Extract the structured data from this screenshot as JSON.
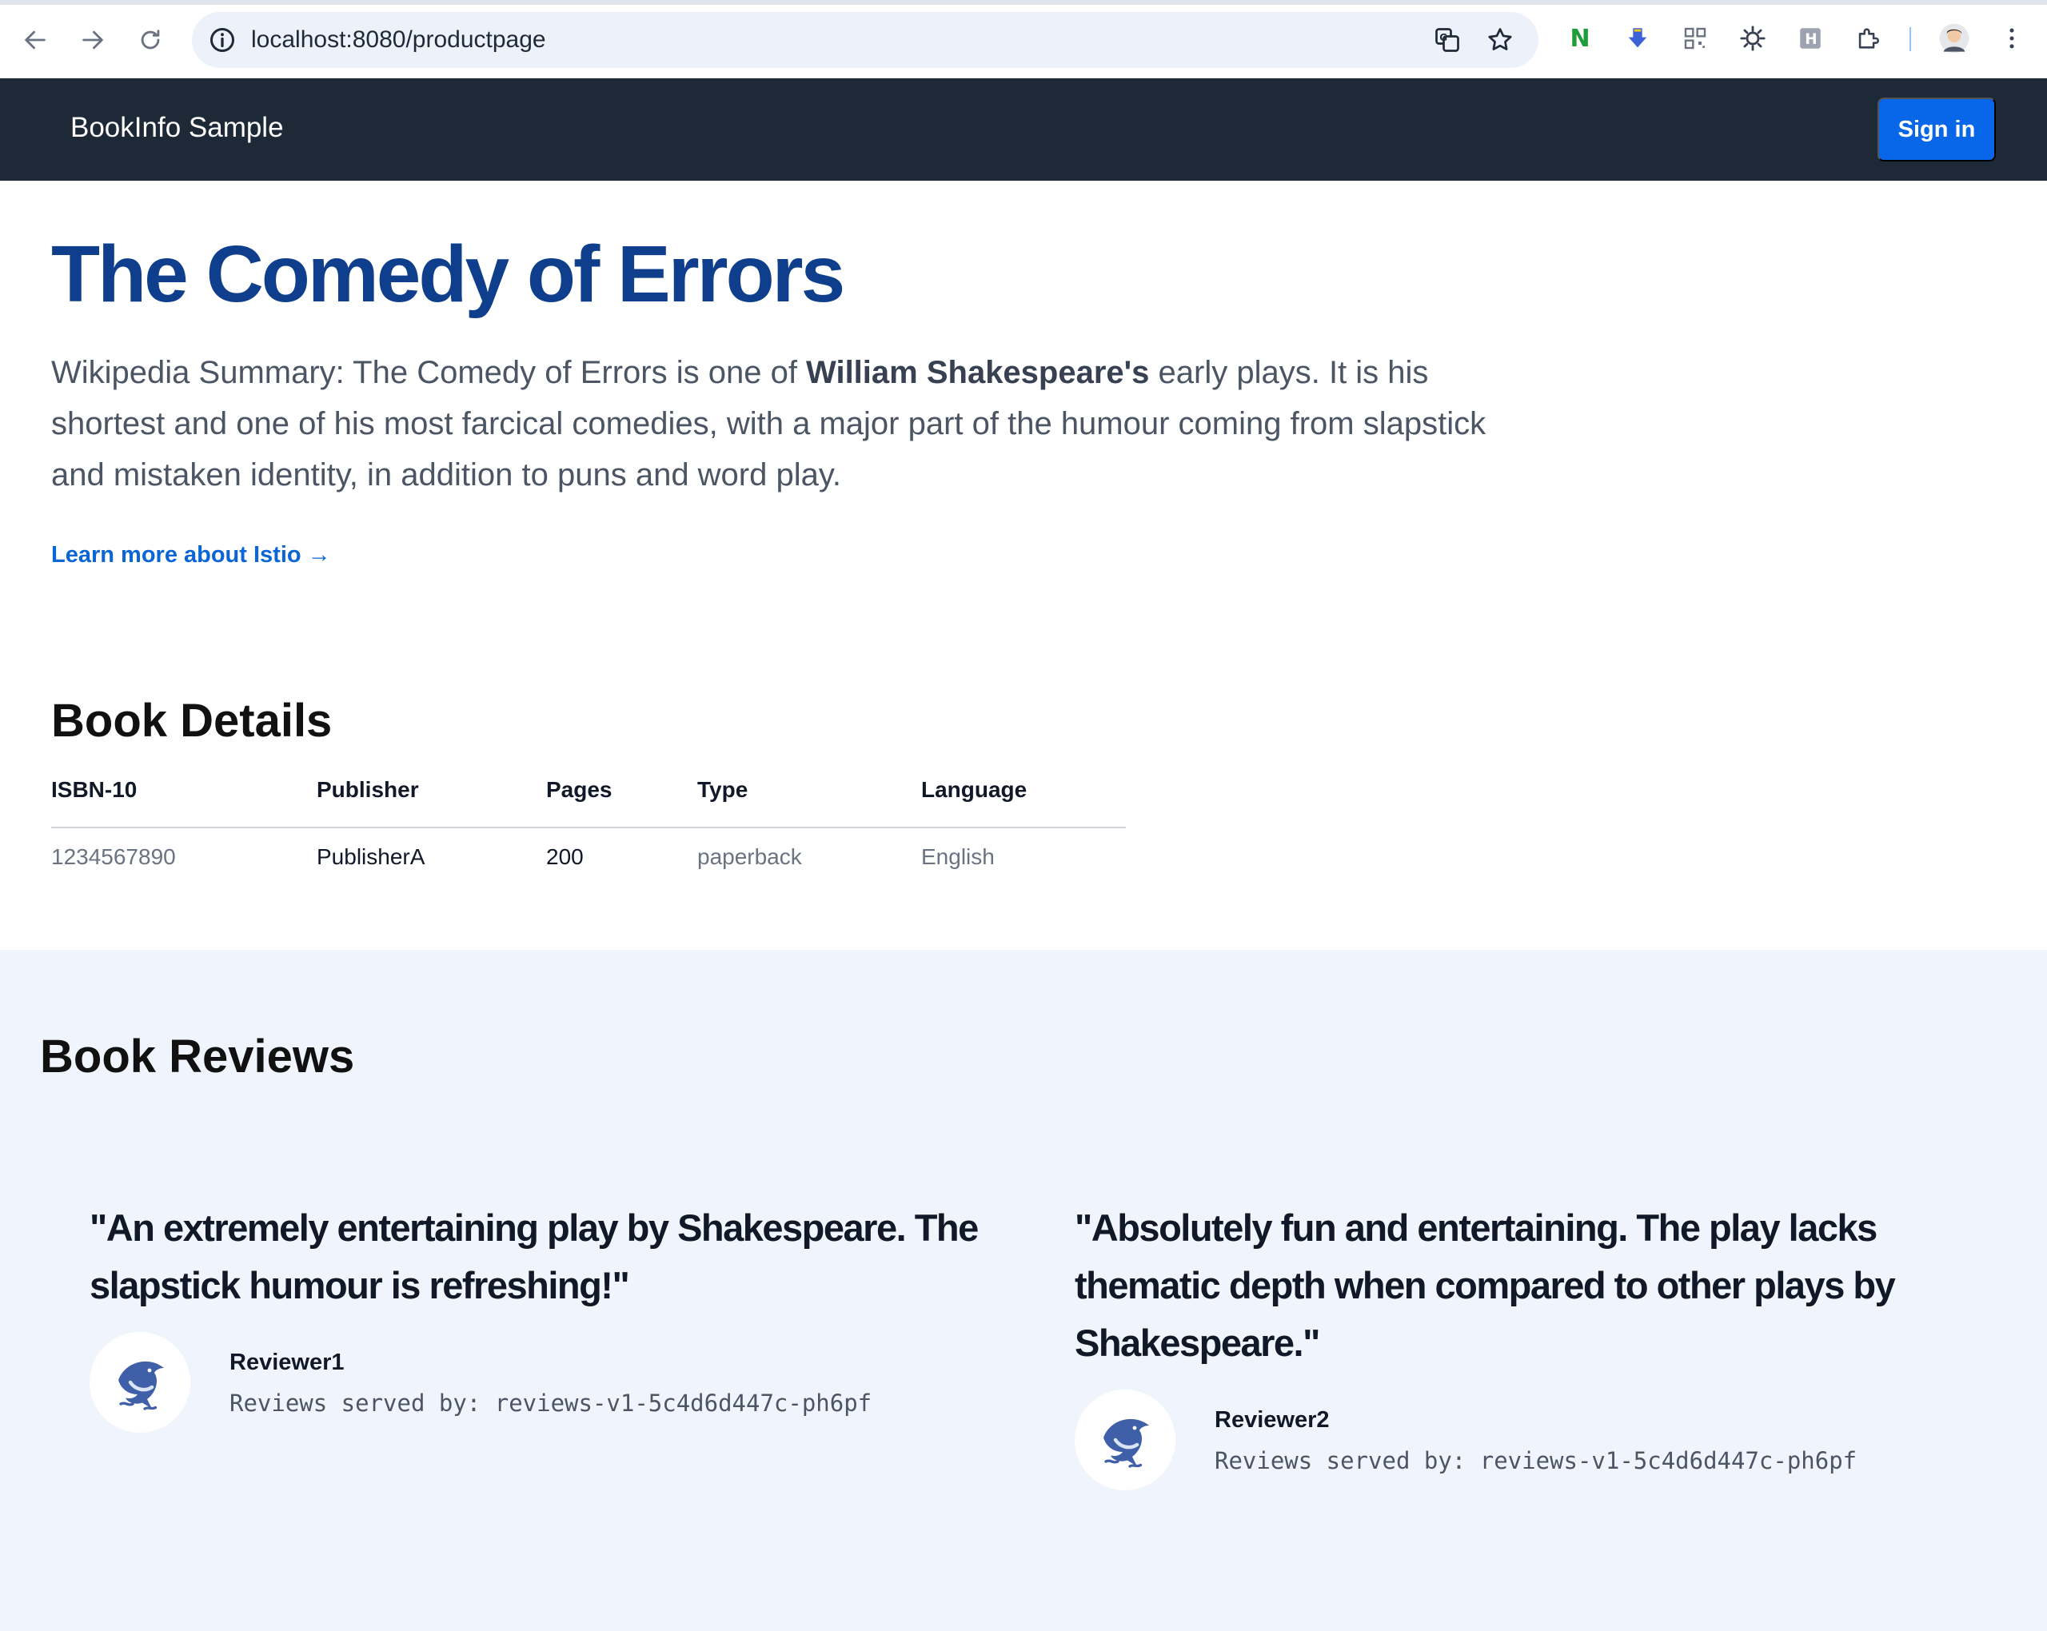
{
  "browser": {
    "url": "localhost:8080/productpage",
    "icons": [
      "back-icon",
      "forward-icon",
      "reload-icon",
      "site-info-icon",
      "translate-icon",
      "bookmark-star-icon",
      "extension-n-icon",
      "extension-download-icon",
      "extension-qr-icon",
      "extension-sun-icon",
      "extension-h-icon",
      "extensions-puzzle-icon",
      "profile-avatar",
      "more-menu-icon"
    ]
  },
  "header": {
    "brand": "BookInfo Sample",
    "signin_label": "Sign in"
  },
  "product": {
    "title": "The Comedy of Errors",
    "summary_prefix": "Wikipedia Summary: The Comedy of Errors is one of ",
    "summary_bold": "William Shakespeare's",
    "summary_suffix": " early plays. It is his shortest and one of his most farcical comedies, with a major part of the humour coming from slapstick and mistaken identity, in addition to puns and word play.",
    "learn_more": "Learn more about Istio →"
  },
  "details": {
    "title": "Book Details",
    "headers": [
      "ISBN-10",
      "Publisher",
      "Pages",
      "Type",
      "Language"
    ],
    "row": [
      "1234567890",
      "PublisherA",
      "200",
      "paperback",
      "English"
    ]
  },
  "reviews": {
    "title": "Book Reviews",
    "items": [
      {
        "text": "\"An extremely entertaining play by Shakespeare. The slapstick humour is refreshing!\"",
        "reviewer": "Reviewer1",
        "served_by": "Reviews served by: reviews-v1-5c4d6d447c-ph6pf"
      },
      {
        "text": "\"Absolutely fun and entertaining. The play lacks thematic depth when compared to other plays by Shakespeare.\"",
        "reviewer": "Reviewer2",
        "served_by": "Reviews served by: reviews-v1-5c4d6d447c-ph6pf"
      }
    ]
  },
  "colors": {
    "header_bg": "#1e2937",
    "title": "#0f3f8c",
    "link": "#0a66d6",
    "button": "#0866e8",
    "reviews_bg": "#f0f5fd"
  }
}
